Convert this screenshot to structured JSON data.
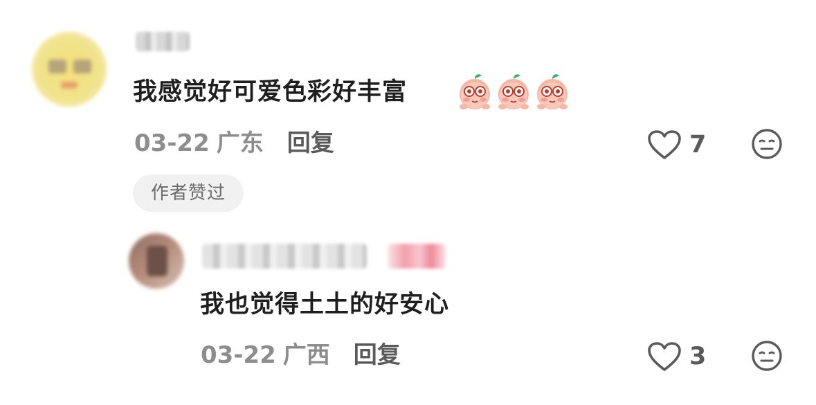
{
  "comment": {
    "text": "我感觉好可爱色彩好丰富",
    "emojis": [
      "peach-blush-emoji",
      "peach-blush-emoji",
      "peach-blush-emoji"
    ],
    "date": "03-22",
    "location": "广东",
    "reply_label": "回复",
    "like_count": "7",
    "author_badge": "作者赞过"
  },
  "reply": {
    "text": "我也觉得土土的好安心",
    "date": "03-22",
    "location": "广西",
    "reply_label": "回复",
    "like_count": "3"
  },
  "colors": {
    "text_primary": "#1f1f1f",
    "text_secondary": "#8d8d8d",
    "icon": "#5a5a5a",
    "badge_bg": "#f1f1f1"
  }
}
